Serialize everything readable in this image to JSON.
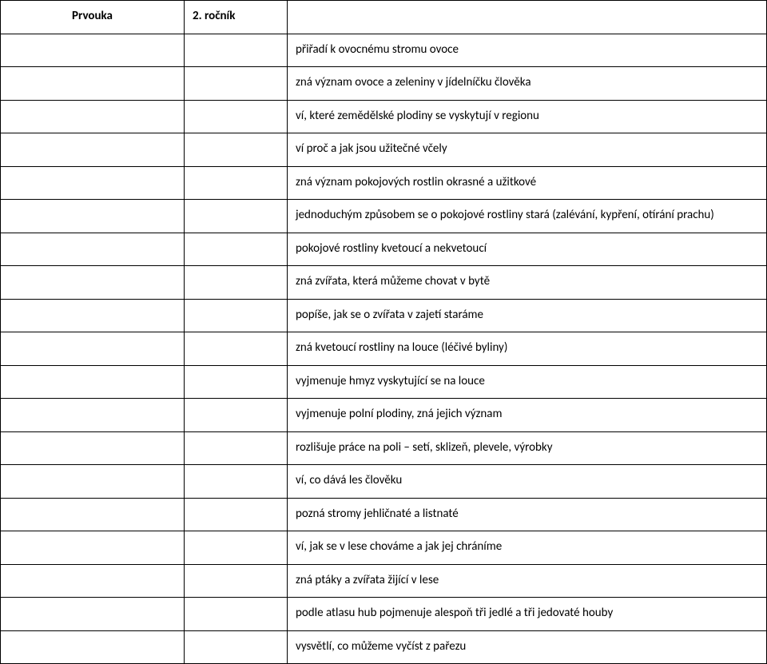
{
  "header": {
    "col1": "Prvouka",
    "col2": "2. ročník",
    "col3": ""
  },
  "rows": [
    "přiřadí k ovocnému stromu ovoce",
    "zná význam ovoce a zeleniny v jídelníčku člověka",
    "ví, které zemědělské plodiny se vyskytují v regionu",
    "ví proč a jak jsou užitečné včely",
    "zná význam pokojových rostlin okrasné a užitkové",
    "jednoduchým způsobem se o pokojové rostliny stará (zalévání, kypření, otírání prachu)",
    "pokojové rostliny kvetoucí a nekvetoucí",
    "zná zvířata, která můžeme chovat v bytě",
    "popíše, jak se o zvířata v zajetí staráme",
    "zná kvetoucí rostliny na louce (léčivé byliny)",
    "vyjmenuje hmyz vyskytující se na louce",
    "vyjmenuje polní plodiny, zná jejich význam",
    "rozlišuje práce na poli – setí, sklizeň, plevele, výrobky",
    "ví, co dává les člověku",
    "pozná stromy jehličnaté a listnaté",
    "ví, jak se v lese chováme a jak jej chráníme",
    "zná ptáky a zvířata žijící v lese",
    "podle atlasu hub pojmenuje alespoň tři jedlé a tři jedovaté houby",
    "vysvětlí, co můžeme vyčíst z pařezu"
  ],
  "justified_row_indices": [
    17
  ]
}
